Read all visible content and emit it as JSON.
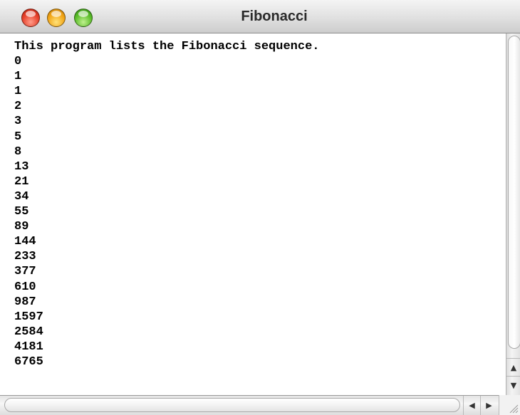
{
  "window": {
    "title": "Fibonacci"
  },
  "console": {
    "lines": [
      "This program lists the Fibonacci sequence.",
      "0",
      "1",
      "1",
      "2",
      "3",
      "5",
      "8",
      "13",
      "21",
      "34",
      "55",
      "89",
      "144",
      "233",
      "377",
      "610",
      "987",
      "1597",
      "2584",
      "4181",
      "6765"
    ]
  },
  "icons": {
    "close": "close-button",
    "minimize": "minimize-button",
    "zoom": "zoom-button",
    "scroll_up": "arrow-up-icon",
    "scroll_down": "arrow-down-icon",
    "scroll_left": "arrow-left-icon",
    "scroll_right": "arrow-right-icon",
    "resize": "resize-grip-icon"
  },
  "colors": {
    "close": "#e6402a",
    "minimize": "#f2a516",
    "zoom": "#5cbd2a",
    "text": "#000000"
  }
}
